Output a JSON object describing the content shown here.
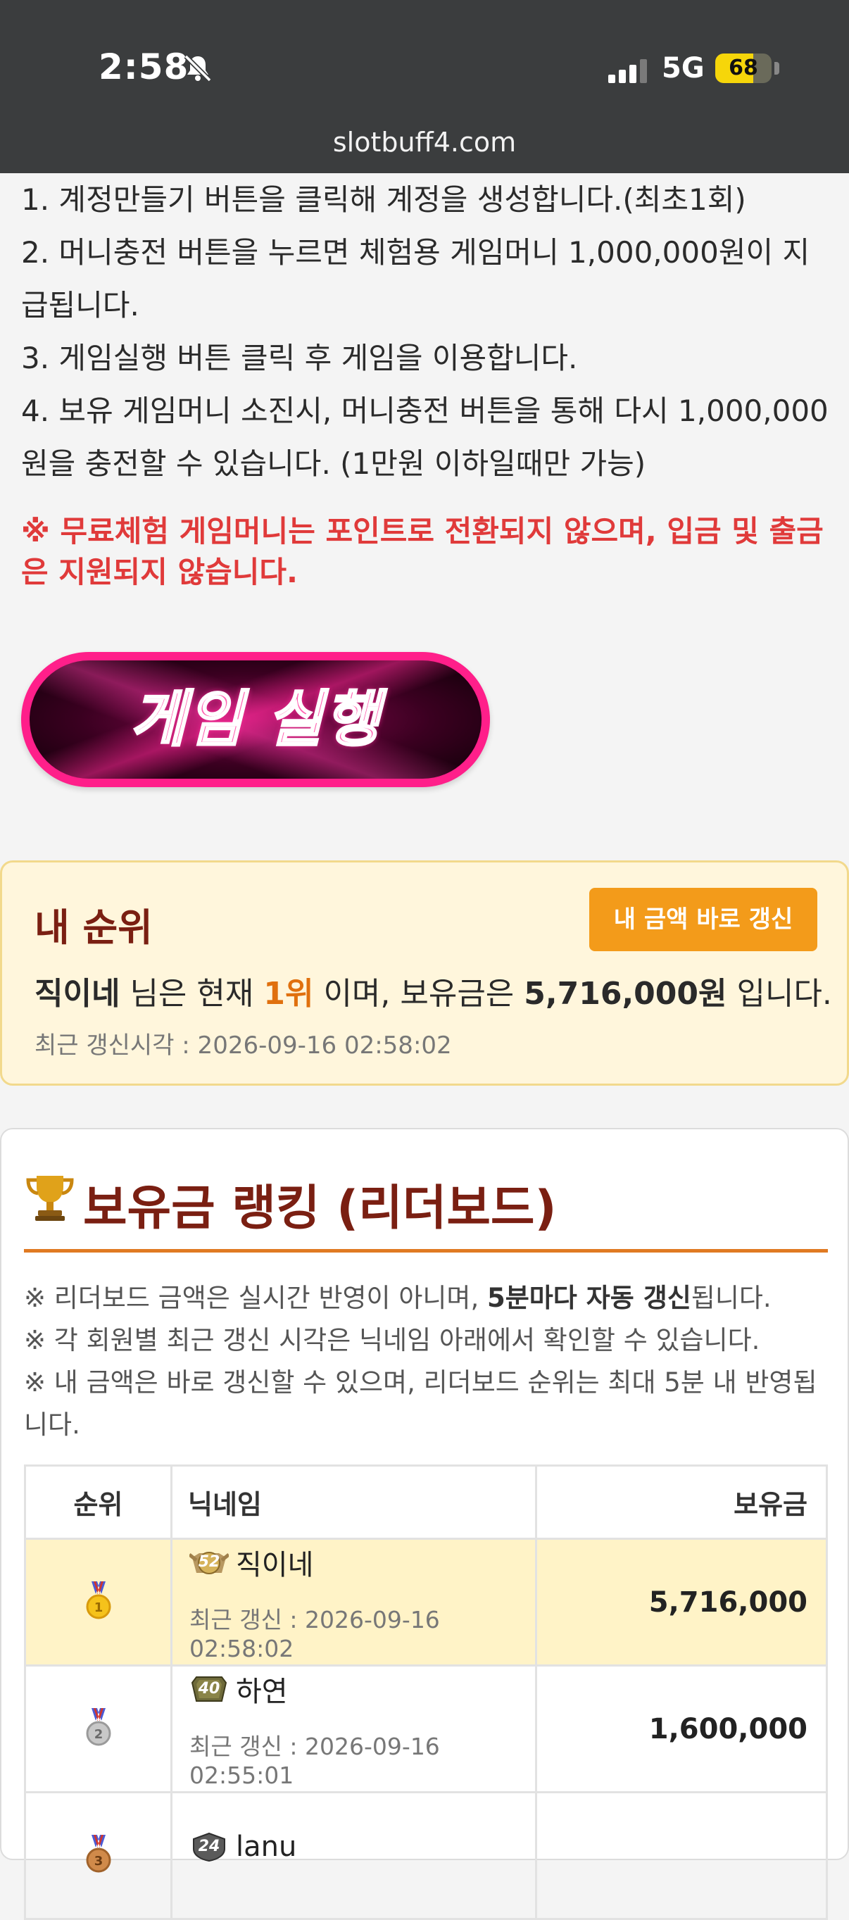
{
  "status": {
    "time": "2:58",
    "network": "5G",
    "battery": "68",
    "battery_level": 0.68
  },
  "browser": {
    "url": "slotbuff4.com"
  },
  "instructions": {
    "steps": [
      "1. 계정만들기 버튼을 클릭해 계정을 생성합니다.(최초1회)",
      "2. 머니충전 버튼을 누르면 체험용 게임머니 1,000,000원이 지급됩니다.",
      "3. 게임실행 버튼 클릭 후 게임을 이용합니다.",
      "4. 보유 게임머니 소진시, 머니충전 버튼을 통해 다시 1,000,000원을 충전할 수 있습니다. (1만원 이하일때만 가능)"
    ],
    "warning": "※ 무료체험 게임머니는 포인트로 전환되지 않으며, 입금 및 출금은 지원되지 않습니다.",
    "play_button_label": "게임 실행"
  },
  "my_rank": {
    "title": "내 순위",
    "refresh_label": "내 금액 바로 갱신",
    "nickname": "직이네",
    "text_1": " 님은 현재 ",
    "rank": "1위",
    "text_2": " 이며, 보유금은 ",
    "amount": "5,716,000원",
    "text_3": " 입니다.",
    "updated": "최근 갱신시각 : 2026-09-16 02:58:02"
  },
  "leaderboard": {
    "title": "보유금 랭킹 (리더보드)",
    "notes": {
      "n1_a": "※ 리더보드 금액은 실시간 반영이 아니며, ",
      "n1_b": "5분마다 자동 갱신",
      "n1_c": "됩니다.",
      "n2": "※ 각 회원별 최근 갱신 시각은 닉네임 아래에서 확인할 수 있습니다.",
      "n3": "※ 내 금액은 바로 갱신할 수 있으며, 리더보드 순위는 최대 5분 내 반영됩니다."
    },
    "headers": {
      "rank": "순위",
      "nickname": "닉네임",
      "money": "보유금"
    },
    "rows": [
      {
        "level": "52",
        "nickname": "직이네",
        "updated": "최근 갱신 : 2026-09-16 02:58:02",
        "money": "5,716,000",
        "medal": "gold",
        "medal_num": "1"
      },
      {
        "level": "40",
        "nickname": "하연",
        "updated": "최근 갱신 : 2026-09-16 02:55:01",
        "money": "1,600,000",
        "medal": "silver",
        "medal_num": "2"
      },
      {
        "level": "24",
        "nickname": "lanu",
        "updated": "",
        "money": "",
        "medal": "bronze",
        "medal_num": "3"
      }
    ]
  },
  "colors": {
    "header_bg": "#3b3d3e",
    "warning_red": "#e03a3a",
    "accent_orange": "#f39b1a",
    "title_brown": "#7a1f12",
    "play_pink": "#ff1f8a"
  }
}
